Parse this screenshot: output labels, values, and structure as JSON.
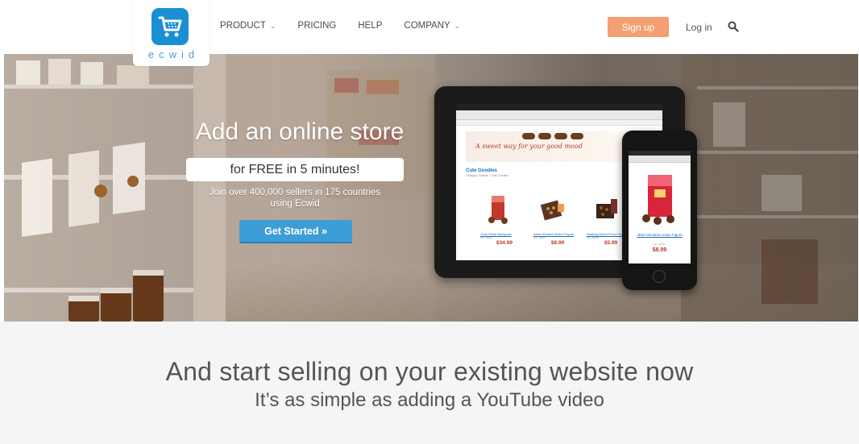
{
  "brand": {
    "logo_text": "ecwid",
    "color": "#1a8fd4"
  },
  "nav": {
    "items": [
      {
        "label": "PRODUCT",
        "has_dropdown": true
      },
      {
        "label": "PRICING",
        "has_dropdown": false
      },
      {
        "label": "HELP",
        "has_dropdown": false
      },
      {
        "label": "COMPANY",
        "has_dropdown": true
      }
    ],
    "signup_label": "Sign up",
    "login_label": "Log in",
    "search_icon": "search-icon",
    "accent_color": "#f49f73"
  },
  "hero": {
    "title": "Add an online store",
    "highlight": "for FREE in 5 minutes!",
    "subtitle_line1": "Join over 400,000 sellers in 175 countries",
    "subtitle_line2": "using Ecwid",
    "cta_label": "Get Started »",
    "cta_color": "#3d9ed7"
  },
  "tablet_demo": {
    "banner_text": "A sweet way for your good mood",
    "category_title": "Cute Goodies",
    "breadcrumb": "Category: Sweets > Cute Goodies",
    "products": [
      {
        "name": "Yoda Plush Backpack",
        "sku": "Sku: 00024",
        "price": "$34.99"
      },
      {
        "name": "Albert Einstein Action Figure",
        "sku": "Sku: 00017",
        "price": "$8.99"
      },
      {
        "name": "Walking Robot Pencil Sharpener",
        "sku": "Sku: 00033",
        "price": "$5.99"
      }
    ]
  },
  "phone_demo": {
    "product_name": "Albert Einstein Action Figure",
    "sku": "Sku: 00017",
    "price": "$8.99"
  },
  "section": {
    "title": "And start selling on your existing website now",
    "subtitle": "It’s as simple as adding a YouTube video"
  }
}
